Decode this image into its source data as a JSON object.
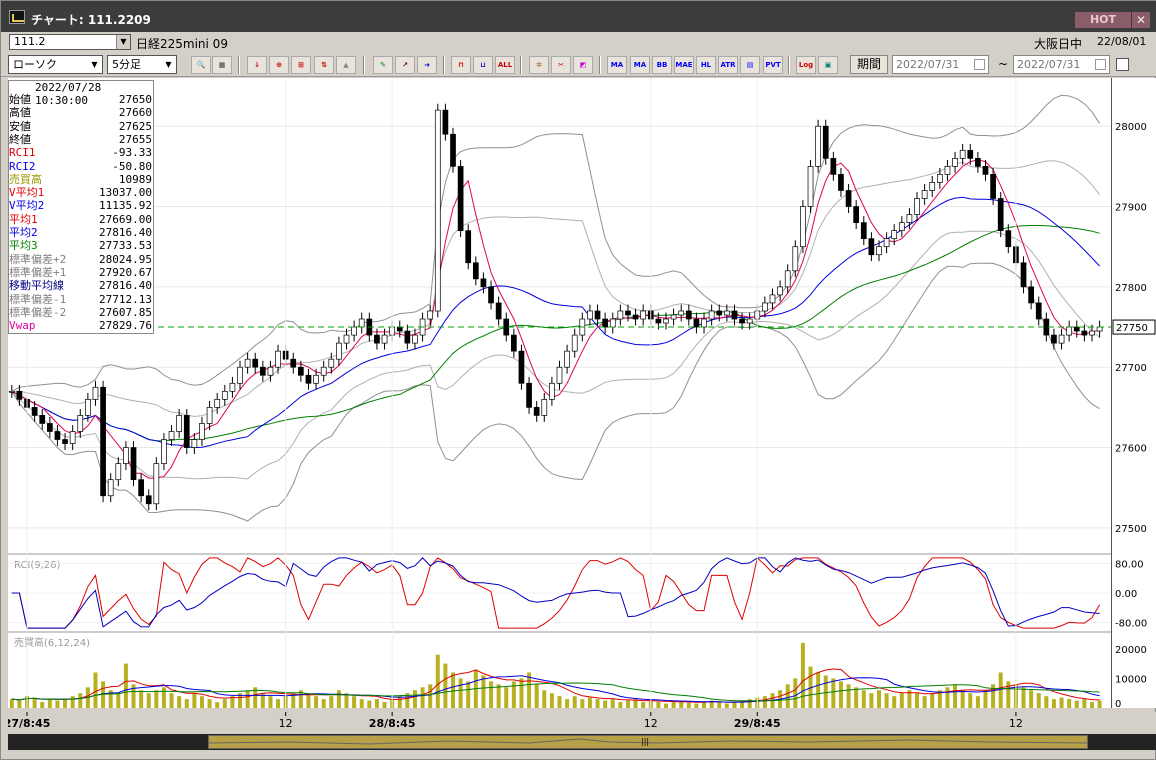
{
  "window": {
    "title": "チャート: 111.2209",
    "hot_label": "HOT",
    "close_glyph": "✕"
  },
  "symbol_bar": {
    "symbol_code": "111.2",
    "symbol_name": "日経225mini 09",
    "session": "大阪日中",
    "date": "22/08/01"
  },
  "toolbar": {
    "chart_type": "ローソク",
    "interval": "5分足",
    "buttons": [
      "MA",
      "BB",
      "MAE",
      "HL",
      "ATR",
      "Log",
      "PVT",
      "ALL"
    ],
    "period_label": "期間",
    "date_from": "2022/07/31",
    "date_to": "2022/07/31",
    "tilde": "~"
  },
  "info_panel": {
    "datetime": "2022/07/28  10:30:00",
    "rows": [
      {
        "label": "始値",
        "value": "27650",
        "color": "#000000"
      },
      {
        "label": "高値",
        "value": "27660",
        "color": "#000000"
      },
      {
        "label": "安値",
        "value": "27625",
        "color": "#000000"
      },
      {
        "label": "終値",
        "value": "27655",
        "color": "#000000"
      },
      {
        "label": "RCI1",
        "value": "-93.33",
        "color": "#e00000"
      },
      {
        "label": "RCI2",
        "value": "-50.80",
        "color": "#0000e0"
      },
      {
        "label": "売買高",
        "value": "10989",
        "color": "#999900"
      },
      {
        "label": "V平均1",
        "value": "13037.00",
        "color": "#e00000"
      },
      {
        "label": "V平均2",
        "value": "11135.92",
        "color": "#0000e0"
      },
      {
        "label": "平均1",
        "value": "27669.00",
        "color": "#e00000"
      },
      {
        "label": "平均2",
        "value": "27816.40",
        "color": "#0000e0"
      },
      {
        "label": "平均3",
        "value": "27733.53",
        "color": "#008000"
      },
      {
        "label": "標準偏差+2",
        "value": "28024.95",
        "color": "#808080"
      },
      {
        "label": "標準偏差+1",
        "value": "27920.67",
        "color": "#808080"
      },
      {
        "label": "移動平均線",
        "value": "27816.40",
        "color": "#000080"
      },
      {
        "label": "標準偏差-1",
        "value": "27712.13",
        "color": "#808080"
      },
      {
        "label": "標準偏差-2",
        "value": "27607.85",
        "color": "#808080"
      },
      {
        "label": "Vwap",
        "value": "27829.76",
        "color": "#e000a0"
      }
    ]
  },
  "chart_data": [
    {
      "type": "candlestick",
      "title": "",
      "y_ticks": [
        "28000",
        "27900",
        "27800",
        "27700",
        "27600",
        "27500"
      ],
      "ylim": [
        27470,
        28060
      ],
      "current_price_label": "27750",
      "current_price": 27750,
      "x_labels": [
        "27/8:45",
        "12",
        "28/8:45",
        "12",
        "29/8:45",
        "12"
      ],
      "close": [
        27670,
        27660,
        27650,
        27640,
        27630,
        27620,
        27610,
        27605,
        27620,
        27640,
        27660,
        27675,
        27540,
        27560,
        27580,
        27600,
        27560,
        27540,
        27530,
        27580,
        27610,
        27620,
        27640,
        27600,
        27610,
        27630,
        27650,
        27660,
        27670,
        27680,
        27700,
        27710,
        27700,
        27690,
        27700,
        27720,
        27710,
        27700,
        27690,
        27680,
        27690,
        27700,
        27710,
        27730,
        27740,
        27750,
        27760,
        27740,
        27730,
        27740,
        27750,
        27745,
        27730,
        27740,
        27760,
        27770,
        28020,
        27990,
        27950,
        27870,
        27830,
        27810,
        27800,
        27780,
        27760,
        27740,
        27720,
        27680,
        27650,
        27640,
        27660,
        27680,
        27700,
        27720,
        27740,
        27760,
        27770,
        27760,
        27750,
        27760,
        27770,
        27765,
        27760,
        27770,
        27760,
        27755,
        27760,
        27765,
        27770,
        27760,
        27750,
        27760,
        27770,
        27765,
        27770,
        27760,
        27755,
        27760,
        27770,
        27780,
        27790,
        27800,
        27820,
        27850,
        27900,
        27950,
        28000,
        27960,
        27940,
        27920,
        27900,
        27880,
        27860,
        27840,
        27850,
        27860,
        27870,
        27880,
        27890,
        27910,
        27920,
        27930,
        27940,
        27950,
        27960,
        27970,
        27960,
        27950,
        27940,
        27910,
        27870,
        27850,
        27830,
        27800,
        27780,
        27760,
        27740,
        27730,
        27740,
        27750,
        27745,
        27740,
        27745,
        27750
      ],
      "volume_ylim": [
        0,
        25000
      ],
      "volume_ticks": [
        "20000",
        "10000",
        "0"
      ],
      "volume": [
        3000,
        2500,
        4000,
        3500,
        2000,
        3000,
        2500,
        3000,
        4000,
        5000,
        7000,
        12000,
        9000,
        6000,
        5000,
        15000,
        8000,
        6000,
        5000,
        6000,
        7000,
        5000,
        4000,
        3000,
        5000,
        4000,
        3000,
        2000,
        3000,
        4000,
        5000,
        6000,
        7000,
        5000,
        4000,
        3000,
        4000,
        5000,
        6000,
        5000,
        4000,
        3000,
        4000,
        6000,
        5000,
        4000,
        3000,
        2500,
        3000,
        2000,
        3000,
        4000,
        5000,
        6000,
        7000,
        8000,
        18000,
        15000,
        12000,
        10000,
        9000,
        13000,
        11000,
        9000,
        8000,
        7000,
        9000,
        10000,
        12000,
        8000,
        6000,
        5000,
        4000,
        3000,
        4000,
        3000,
        3500,
        3000,
        2500,
        3000,
        2000,
        2500,
        3000,
        2000,
        2500,
        2000,
        1500,
        2000,
        2500,
        2000,
        1500,
        2000,
        2500,
        2000,
        1500,
        2000,
        2500,
        3000,
        3500,
        4000,
        5000,
        6000,
        8000,
        10000,
        22000,
        14000,
        12000,
        11000,
        10000,
        9000,
        8000,
        7000,
        6000,
        5000,
        6000,
        5000,
        4000,
        5000,
        6000,
        5000,
        4000,
        5000,
        6000,
        7000,
        8000,
        6000,
        5000,
        4000,
        6000,
        8000,
        12000,
        9000,
        8000,
        7000,
        6000,
        5000,
        4000,
        3000,
        3500,
        3000,
        2500,
        3000,
        2000,
        2500
      ],
      "rci_ticks": [
        "80.00",
        "0.00",
        "-80.00"
      ],
      "rci_label": "RCI(9,26)",
      "volume_label": "売買高(6,12,24)"
    }
  ],
  "scrollbar": {
    "thumb_glyph": "|||"
  }
}
